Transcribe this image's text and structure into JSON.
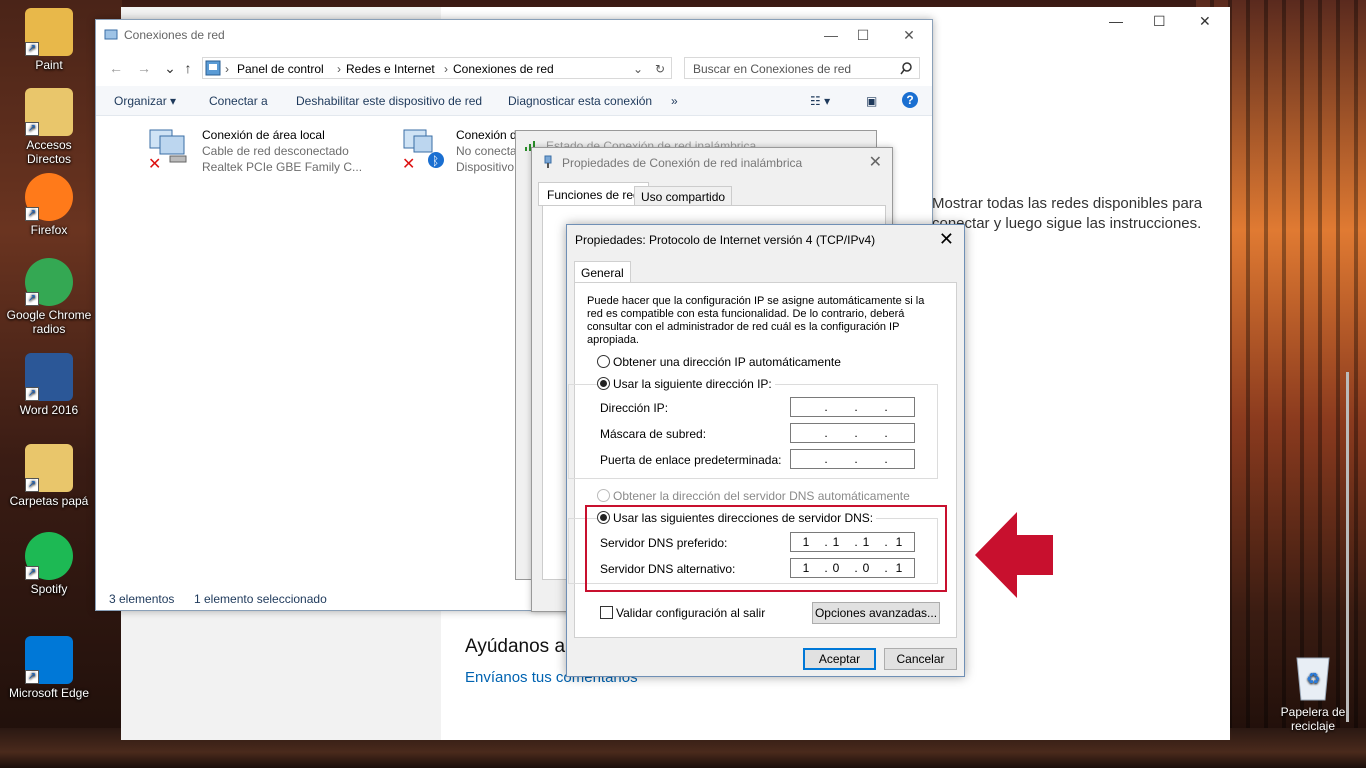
{
  "desktop": {
    "icons": [
      {
        "label": "Paint",
        "color": "#e8b84a"
      },
      {
        "label": "Accesos Directos",
        "color": "#e9c66b"
      },
      {
        "label": "Firefox",
        "color": "#ff7a1a"
      },
      {
        "label": "Google Chrome radios",
        "color": "#34a853"
      },
      {
        "label": "Word 2016",
        "color": "#2b5797"
      },
      {
        "label": "Carpetas papá",
        "color": "#e9c66b"
      },
      {
        "label": "Spotify",
        "color": "#1db954"
      },
      {
        "label": "Microsoft Edge",
        "color": "#0078d7"
      }
    ],
    "recycle_bin": "Papelera de reciclaje"
  },
  "settings": {
    "body_text": "Mostrar todas las redes disponibles para conectar y luego sigue las instrucciones.",
    "help_title": "Ayúdanos a",
    "help_link": "Envíanos tus comentarios"
  },
  "network_window": {
    "title": "Conexiones de red",
    "breadcrumb": [
      "Panel de control",
      "Redes e Internet",
      "Conexiones de red"
    ],
    "search_placeholder": "Buscar en Conexiones de red",
    "commands": [
      "Organizar",
      "Conectar a",
      "Deshabilitar este dispositivo de red",
      "Diagnosticar esta conexión",
      "»"
    ],
    "connections": [
      {
        "name": "Conexión de área local",
        "status": "Cable de red desconectado",
        "device": "Realtek PCIe GBE Family C..."
      },
      {
        "name": "Conexión de red Bluetooth",
        "status": "No conectado",
        "device": "Dispositivo"
      }
    ],
    "status_count": "3 elementos",
    "status_selected": "1 elemento seleccionado"
  },
  "estado_window": {
    "title": "Estado de Conexión de red inalámbrica"
  },
  "props_window": {
    "title": "Propiedades de Conexión de red inalámbrica",
    "tabs": [
      "Funciones de red",
      "Uso compartido"
    ]
  },
  "ipv4_dialog": {
    "title": "Propiedades: Protocolo de Internet versión 4 (TCP/IPv4)",
    "tab": "General",
    "description": "Puede hacer que la configuración IP se asigne automáticamente si la red es compatible con esta funcionalidad. De lo contrario, deberá consultar con el administrador de red cuál es la configuración IP apropiada.",
    "radio_ip_auto": "Obtener una dirección IP automáticamente",
    "radio_ip_manual": "Usar la siguiente dirección IP:",
    "label_ip": "Dirección IP:",
    "label_mask": "Máscara de subred:",
    "label_gateway": "Puerta de enlace predeterminada:",
    "radio_dns_auto": "Obtener la dirección del servidor DNS automáticamente",
    "radio_dns_manual": "Usar las siguientes direcciones de servidor DNS:",
    "label_dns_pref": "Servidor DNS preferido:",
    "label_dns_alt": "Servidor DNS alternativo:",
    "dns_pref": [
      "1",
      "1",
      "1",
      "1"
    ],
    "dns_alt": [
      "1",
      "0",
      "0",
      "1"
    ],
    "validate_label": "Validar configuración al salir",
    "advanced_button": "Opciones avanzadas...",
    "ok_button": "Aceptar",
    "cancel_button": "Cancelar"
  },
  "colors": {
    "highlight_red": "#c8102e",
    "accent_blue": "#0078d7"
  }
}
